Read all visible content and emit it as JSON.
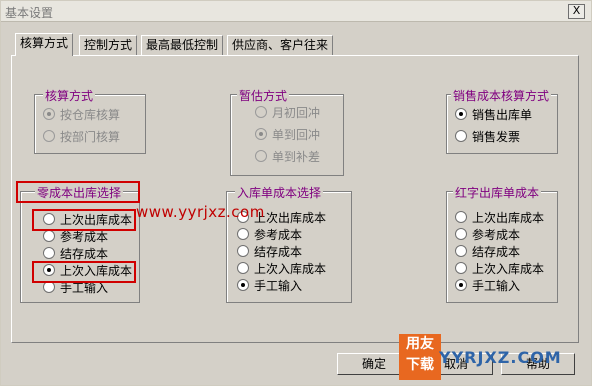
{
  "window": {
    "title": "基本设置",
    "close_label": "X"
  },
  "tabs": [
    {
      "label": "核算方式",
      "active": true
    },
    {
      "label": "控制方式",
      "active": false
    },
    {
      "label": "最高最低控制",
      "active": false
    },
    {
      "label": "供应商、客户往来",
      "active": false
    }
  ],
  "groups": {
    "accounting_method": {
      "title": "核算方式",
      "options": [
        {
          "label": "按仓库核算",
          "selected": true,
          "enabled": false
        },
        {
          "label": "按部门核算",
          "selected": false,
          "enabled": false
        }
      ]
    },
    "provisional": {
      "title": "暂估方式",
      "options": [
        {
          "label": "月初回冲",
          "selected": false,
          "enabled": false
        },
        {
          "label": "单到回冲",
          "selected": true,
          "enabled": false
        },
        {
          "label": "单到补差",
          "selected": false,
          "enabled": false
        }
      ]
    },
    "sales_cost": {
      "title": "销售成本核算方式",
      "options": [
        {
          "label": "销售出库单",
          "selected": true,
          "enabled": true
        },
        {
          "label": "销售发票",
          "selected": false,
          "enabled": true
        }
      ]
    },
    "zero_cost": {
      "title": "零成本出库选择",
      "options": [
        {
          "label": "上次出库成本",
          "selected": false,
          "enabled": true
        },
        {
          "label": "参考成本",
          "selected": false,
          "enabled": true
        },
        {
          "label": "结存成本",
          "selected": false,
          "enabled": true
        },
        {
          "label": "上次入库成本",
          "selected": true,
          "enabled": true
        },
        {
          "label": "手工输入",
          "selected": false,
          "enabled": true
        }
      ]
    },
    "inbound_cost": {
      "title": "入库单成本选择",
      "options": [
        {
          "label": "上次出库成本",
          "selected": false,
          "enabled": true
        },
        {
          "label": "参考成本",
          "selected": false,
          "enabled": true
        },
        {
          "label": "结存成本",
          "selected": false,
          "enabled": true
        },
        {
          "label": "上次入库成本",
          "selected": false,
          "enabled": true
        },
        {
          "label": "手工输入",
          "selected": true,
          "enabled": true
        }
      ]
    },
    "red_out_cost": {
      "title": "红字出库单成本",
      "options": [
        {
          "label": "上次出库成本",
          "selected": false,
          "enabled": true
        },
        {
          "label": "参考成本",
          "selected": false,
          "enabled": true
        },
        {
          "label": "结存成本",
          "selected": false,
          "enabled": true
        },
        {
          "label": "上次入库成本",
          "selected": false,
          "enabled": true
        },
        {
          "label": "手工输入",
          "selected": true,
          "enabled": true
        }
      ]
    }
  },
  "watermark": "www.yyrjxz.com",
  "buttons": {
    "ok": "确定",
    "cancel": "取消",
    "help": "帮助"
  },
  "logo": {
    "line1": "用友",
    "line2": "下载",
    "text": "YYRJXZ.COM"
  },
  "colors": {
    "group_title": "#800080",
    "highlight_box": "#d00000",
    "logo_bg": "#e86820"
  }
}
